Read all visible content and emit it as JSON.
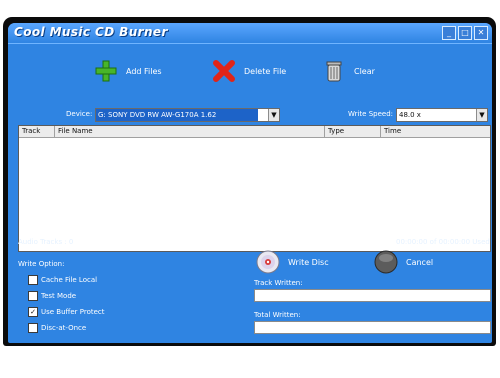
{
  "app": {
    "title": "Cool Music CD Burner",
    "window_buttons": {
      "minimize": "_",
      "maximize": "□",
      "close": "✕"
    }
  },
  "toolbar": {
    "add_files": {
      "label": "Add Files",
      "icon": "plus-icon",
      "color": "#48b52a"
    },
    "delete_file": {
      "label": "Delete File",
      "icon": "delete-x-icon",
      "color": "#e02418"
    },
    "clear": {
      "label": "Clear",
      "icon": "trash-icon"
    }
  },
  "device": {
    "label": "Device:",
    "value": "G: SONY DVD RW AW-G170A 1.62"
  },
  "write_speed": {
    "label": "Write Speed:",
    "value": "48.0 x"
  },
  "tracklist": {
    "columns": [
      "Track",
      "File Name",
      "Type",
      "Time"
    ],
    "rows": []
  },
  "status": {
    "audio_tracks": "Audio Tracks : 0",
    "time_used": "00:00:00 of 00:00:00 Used"
  },
  "write_options": {
    "label": "Write Option:",
    "options": [
      {
        "label": "Cache File Local",
        "checked": false
      },
      {
        "label": "Test Mode",
        "checked": false
      },
      {
        "label": "Use Buffer Protect",
        "checked": true
      },
      {
        "label": "Disc-at-Once",
        "checked": false
      }
    ]
  },
  "actions": {
    "write_disc": "Write Disc",
    "cancel": "Cancel"
  },
  "progress": {
    "track_written_label": "Track Written:",
    "total_written_label": "Total Written:"
  },
  "colors": {
    "window": "#2f84e2",
    "frame": "#0b0b0b"
  }
}
